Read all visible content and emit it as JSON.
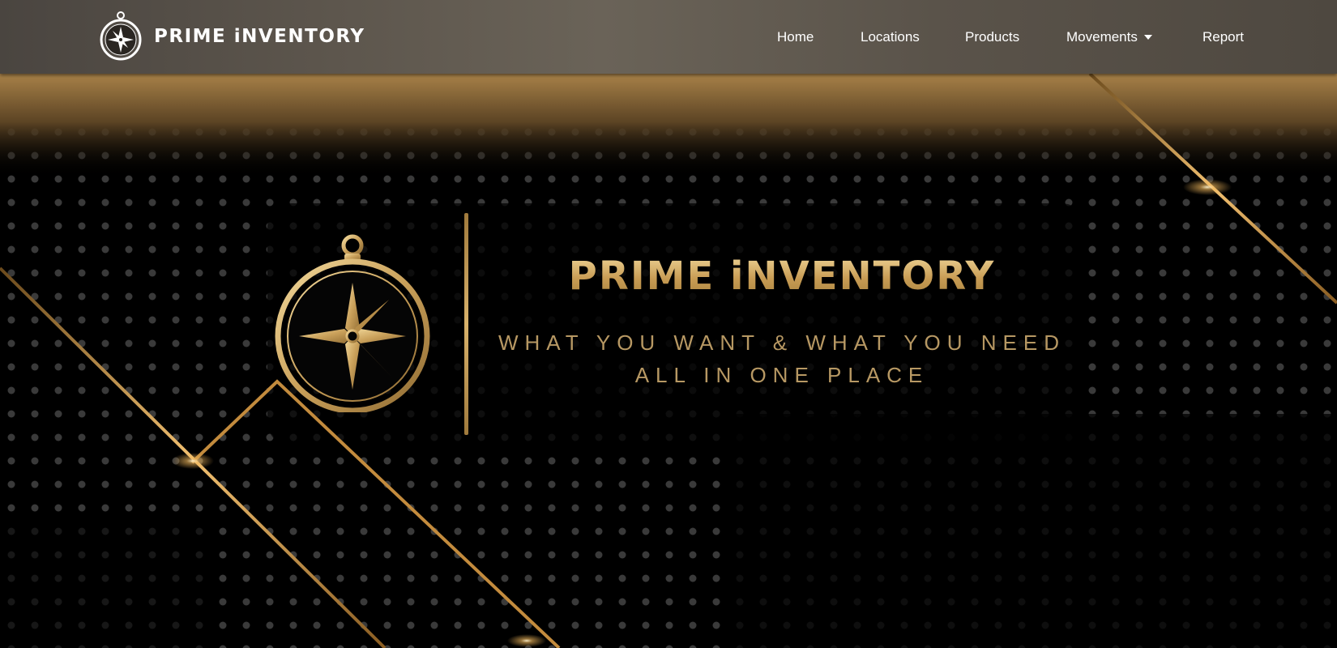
{
  "brand": {
    "name": "PRIME iNVENTORY",
    "icon": "compass-icon"
  },
  "nav": {
    "home": "Home",
    "locations": "Locations",
    "products": "Products",
    "movements": "Movements",
    "report": "Report"
  },
  "hero": {
    "title": "PRIME iNVENTORY",
    "tagline_line1": "WHAT YOU WANT & WHAT YOU NEED",
    "tagline_line2": "ALL IN ONE PLACE",
    "logo_icon": "compass-icon"
  },
  "colors": {
    "gold": "#c89c54",
    "gold_light": "#f1d79a",
    "background": "#000000",
    "navbar": "#5d564d"
  }
}
